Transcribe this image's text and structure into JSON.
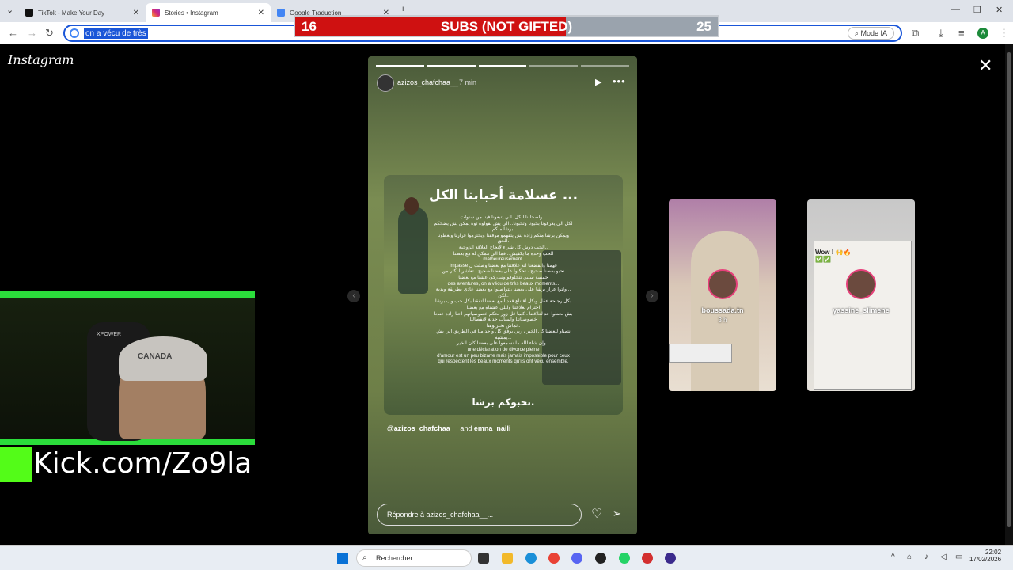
{
  "browser": {
    "tabs": [
      {
        "title": "TikTok - Make Your Day",
        "active": false
      },
      {
        "title": "Stories • Instagram",
        "active": true
      },
      {
        "title": "Google Traduction",
        "active": false
      }
    ],
    "new_tab": "+",
    "omnibox_text": "on a vécu de très",
    "mode_ia": "Mode IA"
  },
  "subs_bar": {
    "left": "16",
    "label": "SUBS (NOT GIFTED)",
    "right": "25",
    "progress": 0.64,
    "fill_color": "#cf1111"
  },
  "instagram": {
    "logo": "Instagram",
    "story": {
      "username": "azizos_chafchaa__",
      "time": "7 min",
      "progress_segments": 5,
      "current_segment": 3,
      "card_title": "عسلامة أحبابنا الكل ...",
      "card_lines": [
        "واصحابنا الكل، الي يتبعونا فينا من سنوات...",
        "لكل الي يعرفونا بحيونا وتحبونا.. الي يش نقولوه توة يمكن يش يضحكم",
        "برشا منكم.",
        "ويمكن برشا منكم زادة يش يتقهمو موقفنا ويحترموا قرارنا ويعطونا",
        "الحق.",
        "الحب دوش كل شيء لإنجاح العلاقة الزوجية..",
        "الحب وحده ما يكفيش.. فما الي ممكن له مع بعضنا",
        "malheureusement.",
        "impasse فهمنا والقضعنا انه علاقتنا مع بعضنا وصلت ل",
        "نحبو بعضنا صحيح ، تحكاوا على بعضنا صحيح ، تعاشرنا أكثر من",
        "خمسة سنين نتحلوقو ونيدركو، عشنا مع بعضنا",
        "des aventures, on a vécu de très beaux moments...",
        "ولتوا عزاز برشا على بعضنا ،تتواصلوا مع بعضنا عادي بطريقة وبدية ..",
        "لكن..",
        "بكل رجاحة عقل وبكل اقتناع قعدنا مع بعضنا اتفقنا بكل حب وب برشا",
        "احترام لعلاقتنا ولللي عشناه مع بعضنا",
        "بش نحطوا حد لعلاقتنا ، كيما قل زوز نحكم خصوصياتهم احنا زادة عندنا",
        "خصوصياتنا وأسباب جدية لانفصالنا",
        "ثماش تخترنوهنا..",
        "نتمناو لبعضنا كل الخير ، ربي يوفق كل واحد منا في الطريق الي يش",
        "يمشيه...",
        "وإن شاء الله ما نسمعوا على بعضنا كان الخير...",
        "une déclaration de divorce pleine",
        "d'amour est un peu bizarre mais jamais impossible pour ceux",
        "qui respectent les beaux moments qu'ils ont vécu ensemble."
      ],
      "card_footer": "نحبوكم برشا.",
      "mentions_user1": "@azizos_chafchaa__",
      "mentions_and": "and",
      "mentions_user2": "emna_naili_",
      "reply_placeholder": "Répondre à azizos_chafchaa__..."
    },
    "next_stories": [
      {
        "username": "boussada.tn",
        "time": "3 h"
      },
      {
        "username": "yassine_slimene",
        "caption": "Wow ! 🙌🔥",
        "checks": "✅✅"
      }
    ]
  },
  "stream": {
    "kick_url": "Kick.com/Zo9la",
    "cap_text": "CANADA",
    "chair_text": "XPOWER",
    "accent": "#53fc18"
  },
  "taskbar": {
    "search": "Rechercher",
    "time": "22:02",
    "date": "17/02/2026"
  }
}
